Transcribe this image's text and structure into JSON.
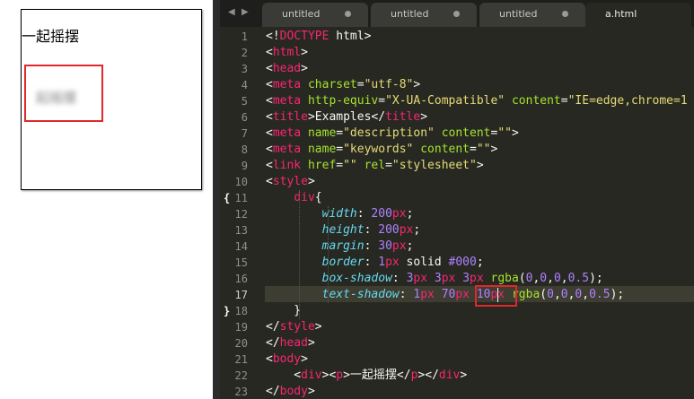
{
  "preview": {
    "text": "一起摇摆",
    "shadow_text": "起摇摆"
  },
  "tabs": [
    {
      "label": "untitled",
      "modified": true,
      "active": false
    },
    {
      "label": "untitled",
      "modified": true,
      "active": false
    },
    {
      "label": "untitled",
      "modified": true,
      "active": false
    },
    {
      "label": "a.html",
      "modified": false,
      "active": true
    }
  ],
  "nav": {
    "prev_icon": "◀",
    "next_icon": "▶"
  },
  "fold": {
    "open": "{",
    "close": "}"
  },
  "gutter": {
    "current_line": 17
  },
  "lines": [
    {
      "n": 1,
      "tokens": [
        {
          "c": "p",
          "t": "<!"
        },
        {
          "c": "tg",
          "t": "DOCTYPE"
        },
        {
          "c": "p",
          "t": " html>"
        }
      ]
    },
    {
      "n": 2,
      "tokens": [
        {
          "c": "p",
          "t": "<"
        },
        {
          "c": "tg",
          "t": "html"
        },
        {
          "c": "p",
          "t": ">"
        }
      ]
    },
    {
      "n": 3,
      "tokens": [
        {
          "c": "p",
          "t": "<"
        },
        {
          "c": "tg",
          "t": "head"
        },
        {
          "c": "p",
          "t": ">"
        }
      ]
    },
    {
      "n": 4,
      "tokens": [
        {
          "c": "p",
          "t": "<"
        },
        {
          "c": "tg",
          "t": "meta"
        },
        {
          "c": "p",
          "t": " "
        },
        {
          "c": "at",
          "t": "charset"
        },
        {
          "c": "p",
          "t": "="
        },
        {
          "c": "st",
          "t": "\"utf-8\""
        },
        {
          "c": "p",
          "t": ">"
        }
      ]
    },
    {
      "n": 5,
      "tokens": [
        {
          "c": "p",
          "t": "<"
        },
        {
          "c": "tg",
          "t": "meta"
        },
        {
          "c": "p",
          "t": " "
        },
        {
          "c": "at",
          "t": "http-equiv"
        },
        {
          "c": "p",
          "t": "="
        },
        {
          "c": "st",
          "t": "\"X-UA-Compatible\""
        },
        {
          "c": "p",
          "t": " "
        },
        {
          "c": "at",
          "t": "content"
        },
        {
          "c": "p",
          "t": "="
        },
        {
          "c": "st",
          "t": "\"IE=edge,chrome=1"
        }
      ]
    },
    {
      "n": 6,
      "tokens": [
        {
          "c": "p",
          "t": "<"
        },
        {
          "c": "tg",
          "t": "title"
        },
        {
          "c": "p",
          "t": ">Examples</"
        },
        {
          "c": "tg",
          "t": "title"
        },
        {
          "c": "p",
          "t": ">"
        }
      ]
    },
    {
      "n": 7,
      "tokens": [
        {
          "c": "p",
          "t": "<"
        },
        {
          "c": "tg",
          "t": "meta"
        },
        {
          "c": "p",
          "t": " "
        },
        {
          "c": "at",
          "t": "name"
        },
        {
          "c": "p",
          "t": "="
        },
        {
          "c": "st",
          "t": "\"description\""
        },
        {
          "c": "p",
          "t": " "
        },
        {
          "c": "at",
          "t": "content"
        },
        {
          "c": "p",
          "t": "="
        },
        {
          "c": "st",
          "t": "\"\""
        },
        {
          "c": "p",
          "t": ">"
        }
      ]
    },
    {
      "n": 8,
      "tokens": [
        {
          "c": "p",
          "t": "<"
        },
        {
          "c": "tg",
          "t": "meta"
        },
        {
          "c": "p",
          "t": " "
        },
        {
          "c": "at",
          "t": "name"
        },
        {
          "c": "p",
          "t": "="
        },
        {
          "c": "st",
          "t": "\"keywords\""
        },
        {
          "c": "p",
          "t": " "
        },
        {
          "c": "at",
          "t": "content"
        },
        {
          "c": "p",
          "t": "="
        },
        {
          "c": "st",
          "t": "\"\""
        },
        {
          "c": "p",
          "t": ">"
        }
      ]
    },
    {
      "n": 9,
      "tokens": [
        {
          "c": "p",
          "t": "<"
        },
        {
          "c": "tg",
          "t": "link"
        },
        {
          "c": "p",
          "t": " "
        },
        {
          "c": "at",
          "t": "href"
        },
        {
          "c": "p",
          "t": "="
        },
        {
          "c": "st",
          "t": "\"\""
        },
        {
          "c": "p",
          "t": " "
        },
        {
          "c": "at",
          "t": "rel"
        },
        {
          "c": "p",
          "t": "="
        },
        {
          "c": "st",
          "t": "\"stylesheet\""
        },
        {
          "c": "p",
          "t": ">"
        }
      ]
    },
    {
      "n": 10,
      "tokens": [
        {
          "c": "p",
          "t": "<"
        },
        {
          "c": "tg",
          "t": "style"
        },
        {
          "c": "p",
          "t": ">"
        }
      ]
    },
    {
      "n": 11,
      "tokens": [
        {
          "c": "p",
          "t": "    "
        },
        {
          "c": "tg",
          "t": "div"
        },
        {
          "c": "p",
          "t": "{"
        }
      ]
    },
    {
      "n": 12,
      "tokens": [
        {
          "c": "p",
          "t": "        "
        },
        {
          "c": "pr",
          "t": "width"
        },
        {
          "c": "p",
          "t": ": "
        },
        {
          "c": "nm",
          "t": "200"
        },
        {
          "c": "un",
          "t": "px"
        },
        {
          "c": "p",
          "t": ";"
        }
      ]
    },
    {
      "n": 13,
      "tokens": [
        {
          "c": "p",
          "t": "        "
        },
        {
          "c": "pr",
          "t": "height"
        },
        {
          "c": "p",
          "t": ": "
        },
        {
          "c": "nm",
          "t": "200"
        },
        {
          "c": "un",
          "t": "px"
        },
        {
          "c": "p",
          "t": ";"
        }
      ]
    },
    {
      "n": 14,
      "tokens": [
        {
          "c": "p",
          "t": "        "
        },
        {
          "c": "pr",
          "t": "margin"
        },
        {
          "c": "p",
          "t": ": "
        },
        {
          "c": "nm",
          "t": "30"
        },
        {
          "c": "un",
          "t": "px"
        },
        {
          "c": "p",
          "t": ";"
        }
      ]
    },
    {
      "n": 15,
      "tokens": [
        {
          "c": "p",
          "t": "        "
        },
        {
          "c": "pr",
          "t": "border"
        },
        {
          "c": "p",
          "t": ": "
        },
        {
          "c": "nm",
          "t": "1"
        },
        {
          "c": "un",
          "t": "px"
        },
        {
          "c": "p",
          "t": " solid "
        },
        {
          "c": "nm",
          "t": "#000"
        },
        {
          "c": "p",
          "t": ";"
        }
      ]
    },
    {
      "n": 16,
      "tokens": [
        {
          "c": "p",
          "t": "        "
        },
        {
          "c": "pr",
          "t": "box-shadow"
        },
        {
          "c": "p",
          "t": ": "
        },
        {
          "c": "nm",
          "t": "3"
        },
        {
          "c": "un",
          "t": "px"
        },
        {
          "c": "p",
          "t": " "
        },
        {
          "c": "nm",
          "t": "3"
        },
        {
          "c": "un",
          "t": "px"
        },
        {
          "c": "p",
          "t": " "
        },
        {
          "c": "nm",
          "t": "3"
        },
        {
          "c": "un",
          "t": "px"
        },
        {
          "c": "p",
          "t": " "
        },
        {
          "c": "at",
          "t": "rgba"
        },
        {
          "c": "p",
          "t": "("
        },
        {
          "c": "nm",
          "t": "0"
        },
        {
          "c": "p",
          "t": ","
        },
        {
          "c": "nm",
          "t": "0"
        },
        {
          "c": "p",
          "t": ","
        },
        {
          "c": "nm",
          "t": "0"
        },
        {
          "c": "p",
          "t": ","
        },
        {
          "c": "nm",
          "t": "0.5"
        },
        {
          "c": "p",
          "t": ");"
        }
      ]
    },
    {
      "n": 17,
      "tokens": [
        {
          "c": "p",
          "t": "        "
        },
        {
          "c": "pr",
          "t": "text-shadow"
        },
        {
          "c": "p",
          "t": ": "
        },
        {
          "c": "nm",
          "t": "1"
        },
        {
          "c": "un",
          "t": "px"
        },
        {
          "c": "p",
          "t": " "
        },
        {
          "c": "nm",
          "t": "70"
        },
        {
          "c": "un",
          "t": "px"
        },
        {
          "c": "p",
          "t": " "
        },
        {
          "c": "nm",
          "t": "10"
        },
        {
          "c": "un",
          "t": "px"
        },
        {
          "c": "p",
          "t": " "
        },
        {
          "c": "at",
          "t": "rgba"
        },
        {
          "c": "p",
          "t": "("
        },
        {
          "c": "nm",
          "t": "0"
        },
        {
          "c": "p",
          "t": ","
        },
        {
          "c": "nm",
          "t": "0"
        },
        {
          "c": "p",
          "t": ","
        },
        {
          "c": "nm",
          "t": "0"
        },
        {
          "c": "p",
          "t": ","
        },
        {
          "c": "nm",
          "t": "0.5"
        },
        {
          "c": "p",
          "t": ");"
        }
      ]
    },
    {
      "n": 18,
      "tokens": [
        {
          "c": "p",
          "t": "    }"
        }
      ]
    },
    {
      "n": 19,
      "tokens": [
        {
          "c": "p",
          "t": "</"
        },
        {
          "c": "tg",
          "t": "style"
        },
        {
          "c": "p",
          "t": ">"
        }
      ]
    },
    {
      "n": 20,
      "tokens": [
        {
          "c": "p",
          "t": "</"
        },
        {
          "c": "tg",
          "t": "head"
        },
        {
          "c": "p",
          "t": ">"
        }
      ]
    },
    {
      "n": 21,
      "tokens": [
        {
          "c": "p",
          "t": "<"
        },
        {
          "c": "tg",
          "t": "body"
        },
        {
          "c": "p",
          "t": ">"
        }
      ]
    },
    {
      "n": 22,
      "tokens": [
        {
          "c": "p",
          "t": "    <"
        },
        {
          "c": "tg",
          "t": "div"
        },
        {
          "c": "p",
          "t": "><"
        },
        {
          "c": "tg",
          "t": "p"
        },
        {
          "c": "p",
          "t": ">一起摇摆</"
        },
        {
          "c": "tg",
          "t": "p"
        },
        {
          "c": "p",
          "t": "></"
        },
        {
          "c": "tg",
          "t": "div"
        },
        {
          "c": "p",
          "t": ">"
        }
      ]
    },
    {
      "n": 23,
      "tokens": [
        {
          "c": "p",
          "t": "</"
        },
        {
          "c": "tg",
          "t": "body"
        },
        {
          "c": "p",
          "t": ">"
        }
      ]
    }
  ]
}
